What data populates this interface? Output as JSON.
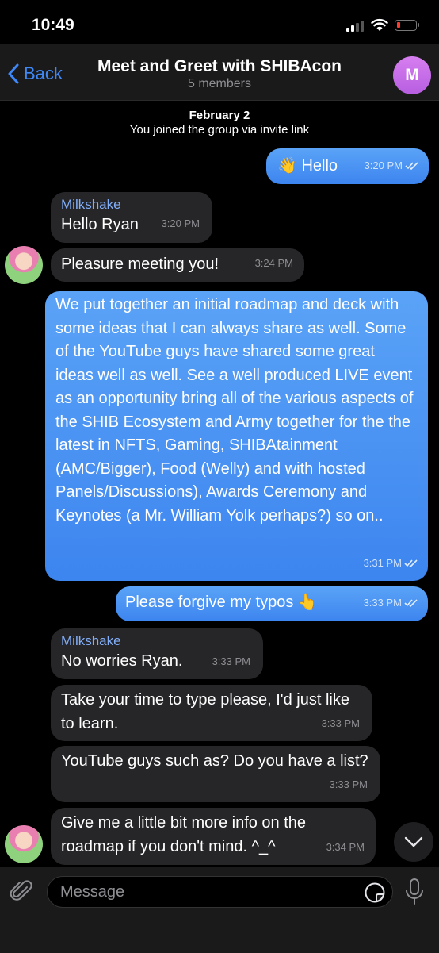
{
  "status": {
    "time": "10:49"
  },
  "header": {
    "back_label": "Back",
    "title": "Meet and Greet with SHIBAcon",
    "subtitle": "5 members",
    "avatar_letter": "M"
  },
  "service": {
    "date": "February 2",
    "joined": "You joined the group via invite link"
  },
  "messages": [
    {
      "text": "👋 Hello",
      "time": "3:20 PM"
    },
    {
      "sender": "Milkshake",
      "text": "Hello Ryan",
      "time": "3:20 PM"
    },
    {
      "text": "Pleasure meeting you!",
      "time": "3:24 PM"
    },
    {
      "text": "We put together an initial roadmap and deck with some ideas that I can always share as well. Some of the YouTube guys have shared some great ideas well as well. See a well produced LIVE event as an opportunity bring all of the various aspects of the SHIB Ecosystem and Army together for the the latest in NFTS, Gaming, SHIBAtainment (AMC/Bigger), Food (Welly) and with hosted Panels/Discussions), Awards Ceremony and Keynotes (a Mr. William Yolk perhaps?) so on..",
      "time": "3:31 PM"
    },
    {
      "text": "Please forgive my typos 👆",
      "time": "3:33 PM"
    },
    {
      "sender": "Milkshake",
      "text": "No worries Ryan.",
      "time": "3:33 PM"
    },
    {
      "text": "Take your time to type please, I'd just like to learn.",
      "time": "3:33 PM"
    },
    {
      "text": "YouTube guys such as? Do you have a list?",
      "time": "3:33 PM"
    },
    {
      "text": "Give me a little bit more info on the roadmap if you don't mind. ^_^",
      "time": "3:34 PM"
    }
  ],
  "composer": {
    "placeholder": "Message"
  },
  "colors": {
    "accent": "#3e88f7",
    "outgoing_bubble": "#3d8ff2",
    "incoming_bubble": "#262628",
    "sender_name": "#82aef8"
  }
}
